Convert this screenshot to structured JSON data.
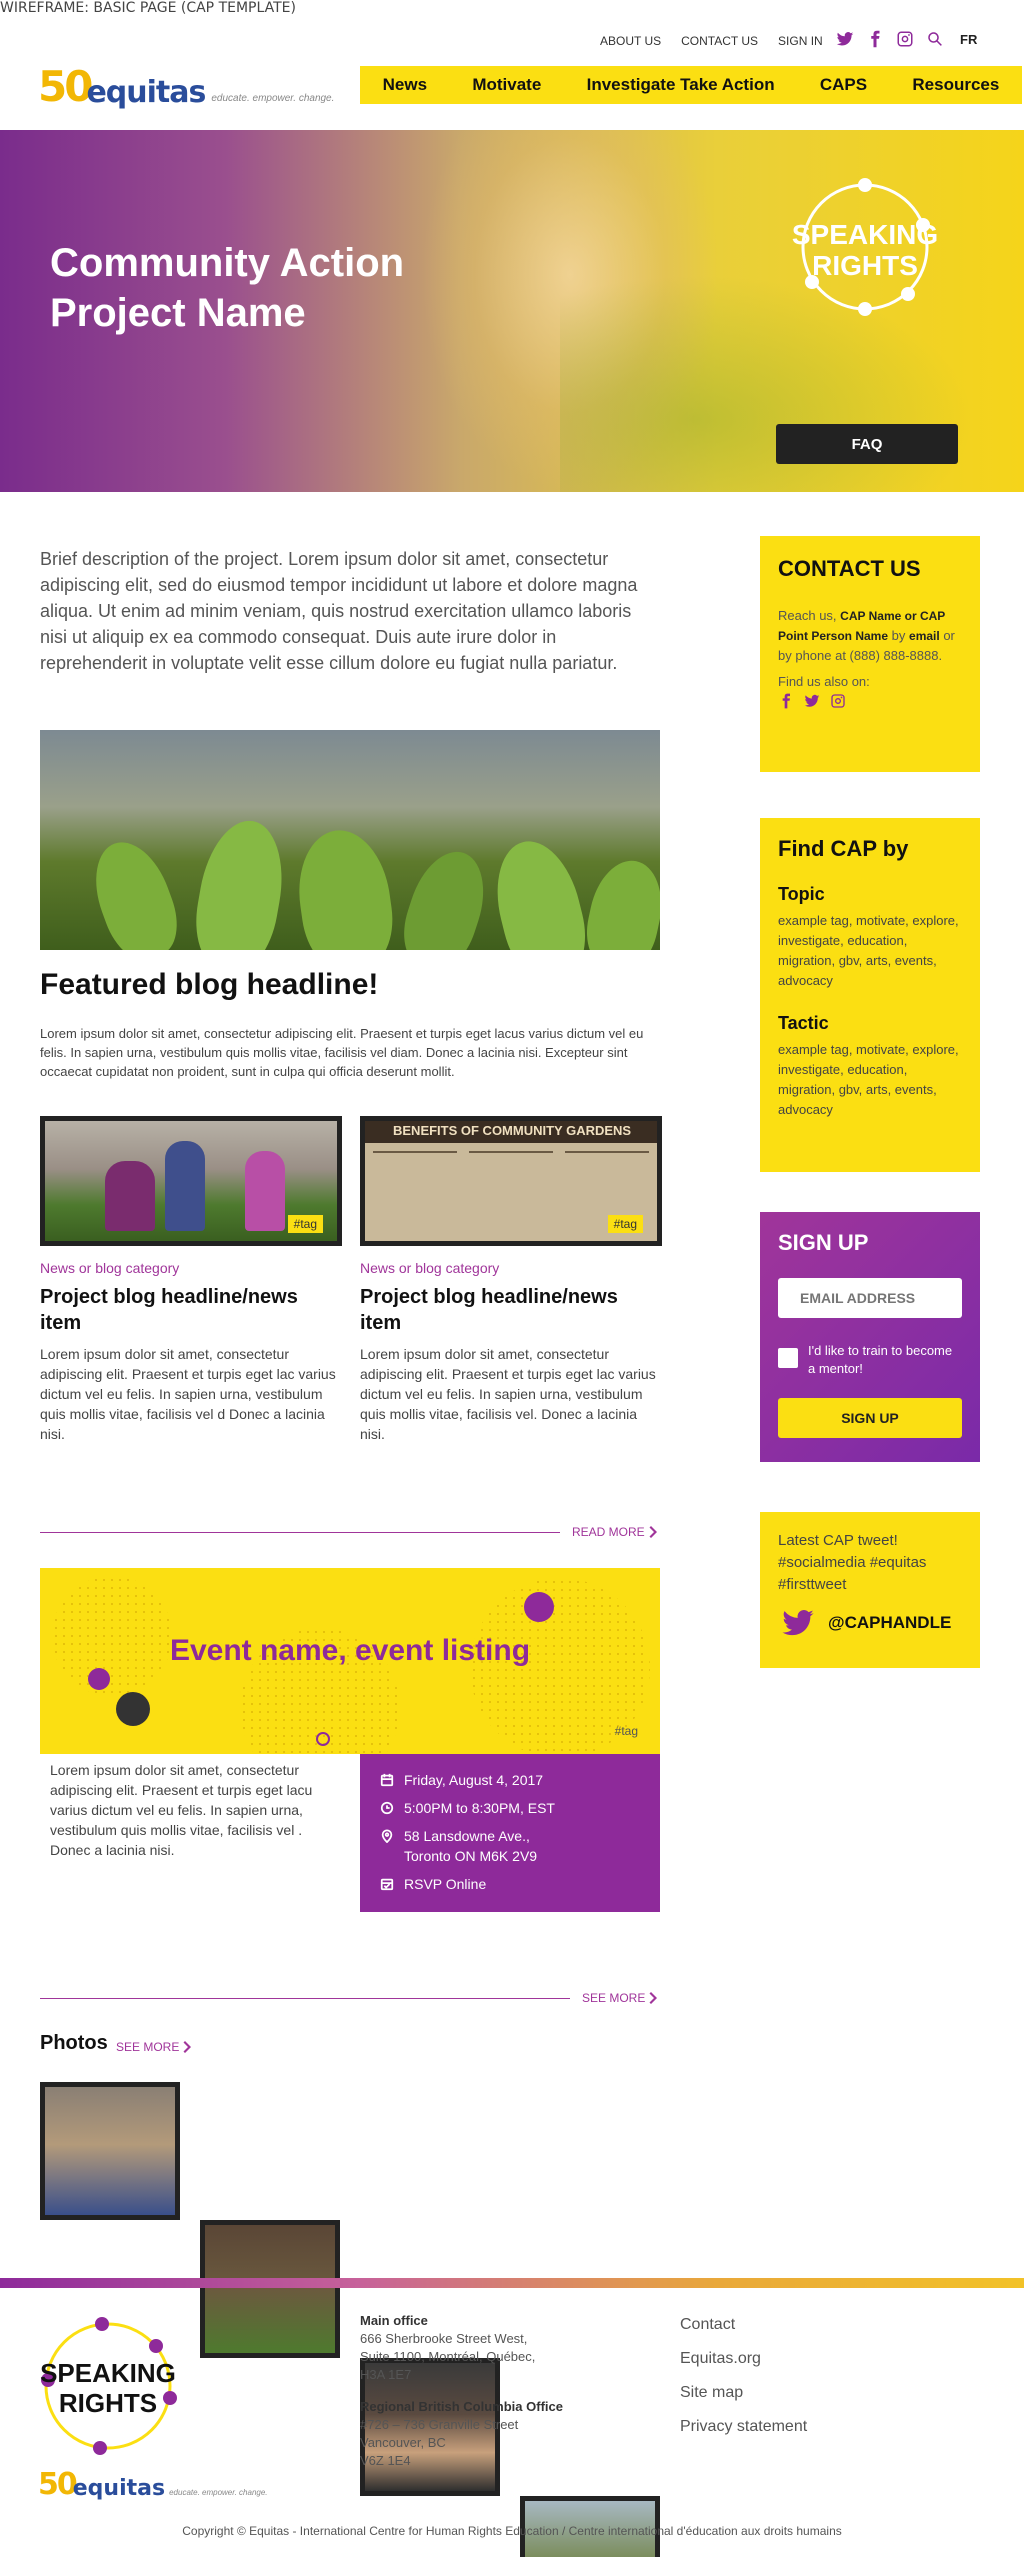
{
  "wireframe_label": "WIREFRAME: BASIC PAGE (CAP TEMPLATE)",
  "top_nav": {
    "about": "ABOUT US",
    "contact": "CONTACT US",
    "signin": "SIGN IN",
    "lang": "FR"
  },
  "logo": {
    "number": "50",
    "word": "equitas",
    "tagline": "educate. empower. change."
  },
  "main_nav": [
    "News",
    "Motivate",
    "Investigate Take Action",
    "CAPS",
    "Resources"
  ],
  "hero": {
    "title_line1": "Community Action",
    "title_line2": "Project Name",
    "badge_line1": "SPEAKING",
    "badge_line2": "RIGHTS",
    "faq": "FAQ"
  },
  "intro": "Brief description of the project. Lorem ipsum dolor sit amet, consectetur adipiscing elit, sed do eiusmod tempor incididunt ut labore et dolore magna aliqua. Ut enim ad minim veniam, quis nostrud exercitation ullamco laboris nisi ut aliquip ex ea commodo consequat. Duis aute irure dolor in reprehenderit in voluptate velit esse cillum dolore eu fugiat nulla pariatur.",
  "featured": {
    "headline": "Featured blog headline!",
    "text": "Lorem ipsum dolor sit amet, consectetur adipiscing elit. Praesent et turpis eget lacus varius dictum vel eu felis. In sapien urna, vestibulum quis mollis vitae, facilisis vel diam. Donec a lacinia nisi. Excepteur sint occaecat cupidatat non proident, sunt in culpa qui officia deserunt mollit."
  },
  "cards": [
    {
      "tag": "#tag",
      "category": "News or blog category",
      "headline": "Project blog headline/news item",
      "text": "Lorem ipsum dolor sit amet, consectetur adipiscing elit. Praesent et turpis eget lac varius dictum vel eu felis. In sapien urna, vestibulum quis mollis vitae, facilisis vel d Donec a lacinia nisi."
    },
    {
      "tag": "#tag",
      "category": "News or blog category",
      "headline": "Project blog headline/news item",
      "text": "Lorem ipsum dolor sit amet, consectetur adipiscing elit. Praesent et turpis eget lac varius dictum vel eu felis. In sapien urna, vestibulum quis mollis vitae, facilisis vel. Donec a lacinia nisi.",
      "poster_title": "BENEFITS OF COMMUNITY GARDENS"
    }
  ],
  "read_more": "READ MORE",
  "event": {
    "name": "Event name, event listing",
    "tag": "#tag",
    "text": "Lorem ipsum dolor sit amet, consectetur adipiscing elit. Praesent et turpis eget lacu varius dictum vel eu felis. In sapien urna, vestibulum quis mollis vitae, facilisis vel . Donec a lacinia nisi.",
    "date": "Friday, August 4, 2017",
    "time": "5:00PM to 8:30PM, EST",
    "address_line1": "58 Lansdowne Ave.,",
    "address_line2": "Toronto ON M6K 2V9",
    "rsvp": "RSVP Online"
  },
  "see_more": "SEE MORE",
  "photos": {
    "heading": "Photos",
    "see_more": "SEE MORE"
  },
  "sidebar": {
    "contact": {
      "title": "CONTACT US",
      "reach": "Reach us,",
      "person": "CAP Name or CAP Point Person Name",
      "by": "by",
      "email": "email",
      "phone": "or by phone at (888) 888-8888.",
      "also": "Find us also on:"
    },
    "findcap": {
      "title": "Find CAP by",
      "topic_h": "Topic",
      "topic_text": "example tag, motivate, explore, investigate, education, migration, gbv, arts, events, advocacy",
      "tactic_h": "Tactic",
      "tactic_text": "example tag, motivate, explore, investigate, education, migration, gbv, arts, events, advocacy"
    },
    "signup": {
      "title": "SIGN UP",
      "email_placeholder": "EMAIL ADDRESS",
      "mentor": "I'd like to train to become a mentor!",
      "button": "SIGN UP"
    },
    "tweet": {
      "text": "Latest CAP tweet! #socialmedia #equitas #firsttweet",
      "handle": "@CAPHANDLE"
    }
  },
  "footer": {
    "badge_line1": "SPEAKING",
    "badge_line2": "RIGHTS",
    "main_office_h": "Main office",
    "main_office_1": "666 Sherbrooke Street West,",
    "main_office_2": "Suite 1100, Montréal, Québec,",
    "main_office_3": "H3A 1E7",
    "bc_office_h": "Regional British Columbia Office",
    "bc_office_1": "#726 – 736 Granville Street",
    "bc_office_2": "Vancouver, BC",
    "bc_office_3": "V6Z 1E4",
    "links": [
      "Contact",
      "Equitas.org",
      "Site map",
      "Privacy statement"
    ],
    "copyright": "Copyright © Equitas - International Centre for Human Rights Education / Centre international d'éducation aux droits humains"
  },
  "colors": {
    "accent_yellow": "#fbdf12",
    "accent_purple": "#8e2a9a",
    "logo_blue": "#2a4d9b"
  }
}
